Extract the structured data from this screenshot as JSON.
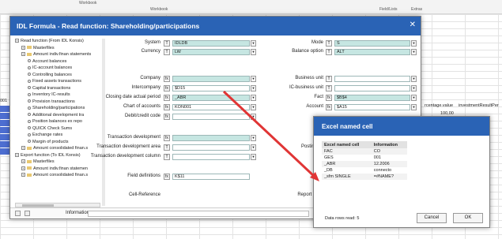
{
  "excel": {
    "ribbon": [
      "Workbook",
      "Workbook",
      "Field/Lists",
      "Extras"
    ],
    "cells": [
      "rcentage.value",
      "investmentResultPer",
      "100,00"
    ],
    "row_label": "001"
  },
  "dialog": {
    "title": "IDL Formula - Read function: Shareholding/participations",
    "close": "✕",
    "tree": [
      {
        "label": "Read function (From IDL Konsis)",
        "kind": "expander",
        "indent": 0
      },
      {
        "label": "Masterfiles",
        "kind": "expander",
        "indent": 1
      },
      {
        "label": "Amount indiv.finan statements",
        "kind": "expander",
        "indent": 1
      },
      {
        "label": "Account balances",
        "kind": "leaf",
        "indent": 2
      },
      {
        "label": "IC-account balances",
        "kind": "leaf",
        "indent": 2
      },
      {
        "label": "Controlling balances",
        "kind": "leaf",
        "indent": 2
      },
      {
        "label": "Fixed assets transactions",
        "kind": "leaf",
        "indent": 2
      },
      {
        "label": "Capital transactions",
        "kind": "leaf",
        "indent": 2
      },
      {
        "label": "Inventory IC-results",
        "kind": "leaf",
        "indent": 2
      },
      {
        "label": "Provision transactions",
        "kind": "leaf",
        "indent": 2
      },
      {
        "label": "Shareholding/participations",
        "kind": "leaf",
        "indent": 2
      },
      {
        "label": "Additional development tra",
        "kind": "leaf",
        "indent": 2
      },
      {
        "label": "Position balances ex repo",
        "kind": "leaf",
        "indent": 2
      },
      {
        "label": "QUICK Check Sums",
        "kind": "leaf",
        "indent": 2
      },
      {
        "label": "Exchange rates",
        "kind": "leaf",
        "indent": 2
      },
      {
        "label": "Margin of products",
        "kind": "leaf",
        "indent": 2
      },
      {
        "label": "Amount consolidated finan.s",
        "kind": "expander",
        "indent": 1
      },
      {
        "label": "Export function (To IDL Konsis)",
        "kind": "expander",
        "indent": 0
      },
      {
        "label": "Masterfiles",
        "kind": "expander",
        "indent": 1
      },
      {
        "label": "Amount indiv.finan statemen",
        "kind": "expander",
        "indent": 1
      },
      {
        "label": "Amount consolidated finan.s",
        "kind": "expander",
        "indent": 1
      }
    ],
    "left_fields": [
      {
        "label": "System",
        "btn": "T",
        "value": "IDLDB",
        "teal": true,
        "dropdown": true
      },
      {
        "label": "Currency",
        "btn": "T",
        "value": "LW",
        "teal": true,
        "dropdown": true
      },
      {
        "label": "Company",
        "btn": "fx",
        "value": "",
        "teal": true,
        "dropdown": true
      },
      {
        "label": "Intercompany",
        "btn": "fx",
        "value": "$D15",
        "teal": false,
        "dropdown": true
      },
      {
        "label": "Closing date actual period",
        "btn": "fx",
        "value": "_ABR",
        "teal": true,
        "dropdown": true
      },
      {
        "label": "Chart of accounts",
        "btn": "fx",
        "value": "KON001",
        "teal": false,
        "dropdown": true
      },
      {
        "label": "Debit/credit code",
        "btn": "fx",
        "value": "",
        "teal": false,
        "dropdown": true
      },
      {
        "label": "Transaction development",
        "btn": "fx",
        "value": "",
        "teal": true,
        "dropdown": true
      },
      {
        "label": "Transaction development area",
        "btn": "T",
        "value": "",
        "teal": false,
        "dropdown": true
      },
      {
        "label": "Transaction development column",
        "btn": "T",
        "value": "",
        "teal": false,
        "dropdown": true
      },
      {
        "label": "Field definitions",
        "btn": "fx",
        "value": "K$11",
        "teal": false,
        "dropdown": false
      },
      {
        "label": "Cell-Reference",
        "btn": "",
        "value": "",
        "teal": false,
        "dropdown": false
      }
    ],
    "right_fields": [
      {
        "label": "Mode",
        "btn": "T",
        "value": "S",
        "teal": true
      },
      {
        "label": "Balance option",
        "btn": "T",
        "value": "ALT",
        "teal": true
      },
      {
        "label": "Business unit",
        "btn": "T",
        "value": "",
        "teal": false
      },
      {
        "label": "IC-business unit",
        "btn": "T",
        "value": "",
        "teal": false
      },
      {
        "label": "Fact",
        "btn": "fx",
        "value": "$B$4",
        "teal": true
      },
      {
        "label": "Account",
        "btn": "fx",
        "value": "$A15",
        "teal": false
      },
      {
        "label": "Posting ke",
        "btn": "",
        "value": "",
        "teal": false
      },
      {
        "label": "Report ident",
        "btn": "",
        "value": "",
        "teal": false
      }
    ],
    "info_label": "Information"
  },
  "named_cell": {
    "title": "Excel named cell",
    "col_name": "Excel named cell",
    "col_info": "Information",
    "rows": [
      {
        "name": "FAC",
        "info": "CO"
      },
      {
        "name": "GES",
        "info": "001"
      },
      {
        "name": "_ABR",
        "info": "12.2006"
      },
      {
        "name": "_DB",
        "info": "connecto"
      },
      {
        "name": "_sfm SINGLE",
        "info": "=#NAME?"
      }
    ],
    "status": "Data rows read: 5",
    "cancel": "Cancel",
    "ok": "OK"
  },
  "colors": {
    "title_bar": "#2a63b5",
    "teal_field": "#c6e6e2",
    "arrow": "#e03535",
    "row_highlight": "#4d6ed1"
  }
}
